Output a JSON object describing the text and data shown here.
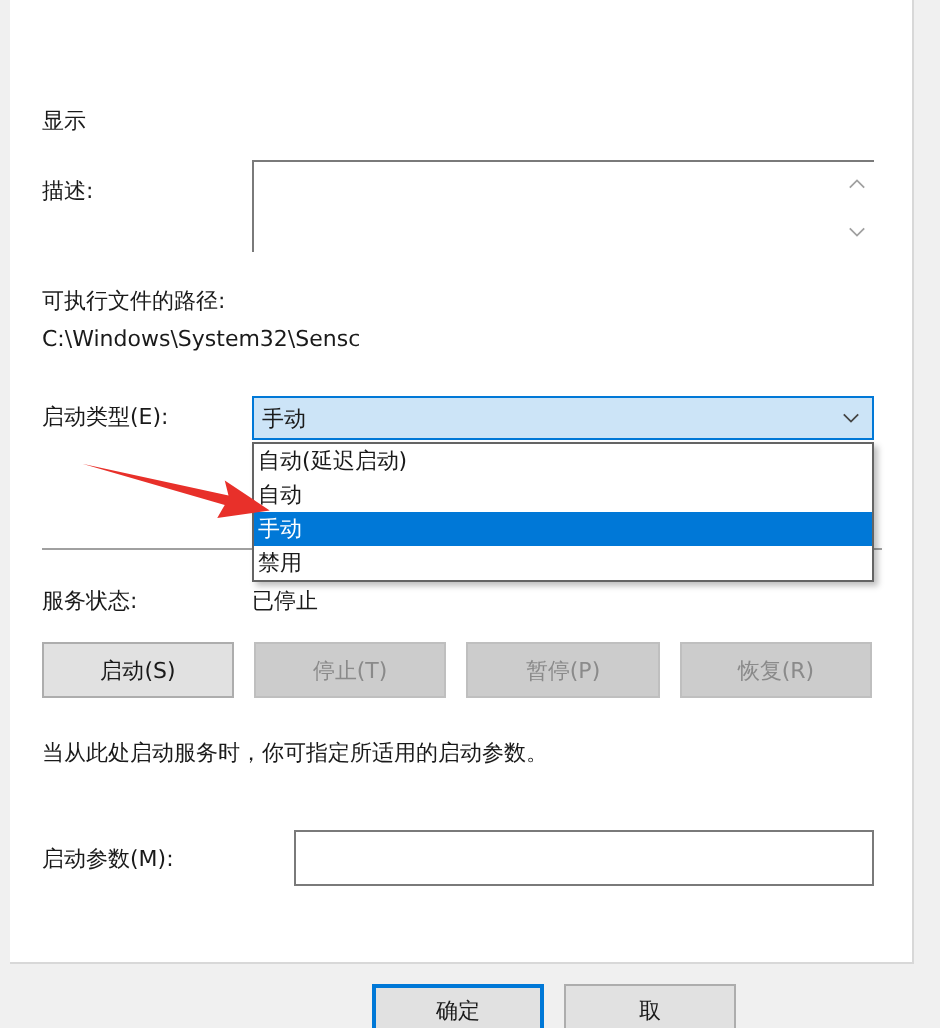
{
  "general": {
    "display_name_label": "显示",
    "description_label": "描述:",
    "path_label": "可执行文件的路径:",
    "path": "C:\\Windows\\System32\\Sensc"
  },
  "startup_type": {
    "label": "启动类型(E):",
    "value": "手动",
    "expanded": true,
    "options": [
      {
        "label": "自动(延迟启动)",
        "selected": false
      },
      {
        "label": "自动",
        "selected": false
      },
      {
        "label": "手动",
        "selected": true
      },
      {
        "label": "禁用",
        "selected": false
      }
    ]
  },
  "service_status": {
    "label": "服务状态:",
    "value": "已停止"
  },
  "service_buttons": [
    {
      "label": "启动(S)",
      "disabled": false
    },
    {
      "label": "停止(T)",
      "disabled": true
    },
    {
      "label": "暂停(P)",
      "disabled": true
    },
    {
      "label": "恢复(R)",
      "disabled": true
    }
  ],
  "hint": "当从此处启动服务时，你可指定所适用的启动参数。",
  "start_params": {
    "label": "启动参数(M):"
  },
  "dialog_buttons": [
    {
      "label": "确定",
      "default": true
    },
    {
      "label": "取",
      "default": false
    }
  ]
}
